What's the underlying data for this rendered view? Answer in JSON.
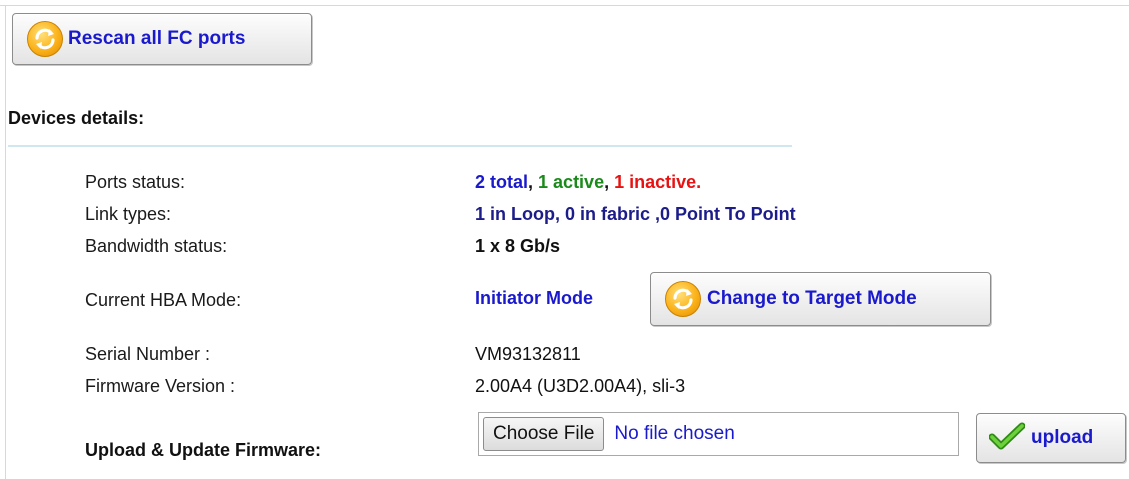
{
  "toolbar": {
    "rescan_label": "Rescan all FC ports"
  },
  "section": {
    "title": "Devices details:"
  },
  "details": {
    "ports_status": {
      "label": "Ports status:",
      "total": "2 total",
      "sep1": ", ",
      "active": "1 active",
      "sep2": ", ",
      "inactive": "1 inactive."
    },
    "link_types": {
      "label": "Link types:",
      "value": "1 in Loop, 0 in fabric ,0 Point To Point"
    },
    "bandwidth": {
      "label": "Bandwidth status:",
      "value": "1 x 8 Gb/s"
    },
    "hba_mode": {
      "label": "Current HBA Mode:",
      "value": "Initiator Mode",
      "change_label": "Change to Target Mode"
    },
    "serial": {
      "label": "Serial Number :",
      "value": "VM93132811"
    },
    "firmware": {
      "label": "Firmware Version :",
      "value": "2.00A4 (U3D2.00A4), sli-3"
    }
  },
  "upload": {
    "label": "Upload & Update Firmware:",
    "choose_label": "Choose File",
    "file_status": "No file chosen",
    "upload_label": "upload"
  },
  "colors": {
    "link_blue": "#1a1acc",
    "active_green": "#1a8a1a",
    "inactive_red": "#e81212",
    "rule": "#cfe8ef",
    "icon_orange": "#fbb21a"
  },
  "icons": {
    "refresh": "refresh-icon",
    "check": "check-icon"
  }
}
